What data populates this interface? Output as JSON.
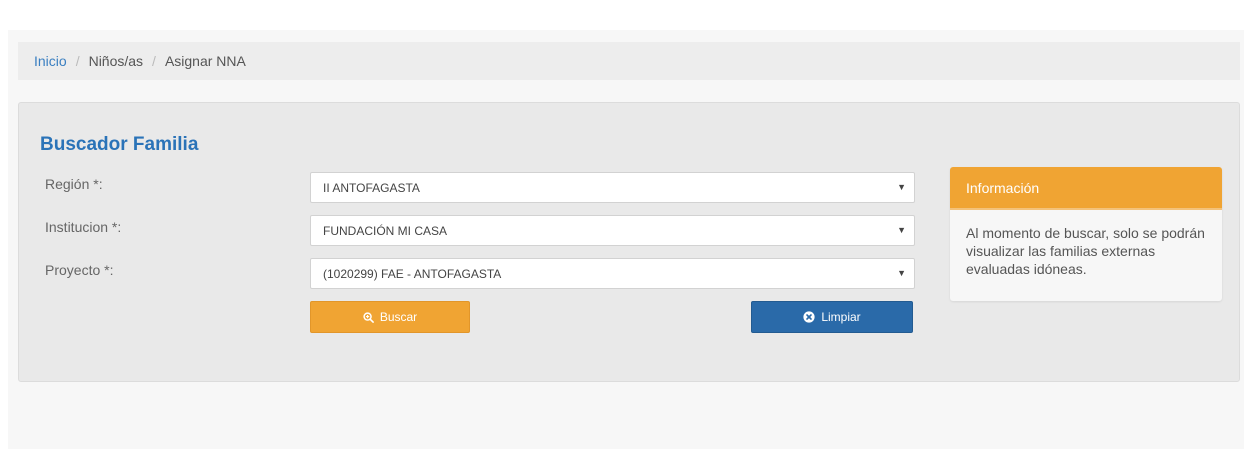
{
  "breadcrumb": {
    "items": [
      "Inicio",
      "Niños/as",
      "Asignar NNA"
    ],
    "separator": "/"
  },
  "panel": {
    "title": "Buscador Familia"
  },
  "form": {
    "region": {
      "label": "Región *:",
      "value": "II ANTOFAGASTA"
    },
    "institucion": {
      "label": "Institucion *:",
      "value": "FUNDACIÓN MI CASA"
    },
    "proyecto": {
      "label": "Proyecto *:",
      "value": "(1020299) FAE - ANTOFAGASTA"
    }
  },
  "buttons": {
    "buscar": {
      "label": "Buscar",
      "icon": "zoom-in-icon",
      "color": "#f0a433"
    },
    "limpiar": {
      "label": "Limpiar",
      "icon": "remove-circle-icon",
      "color": "#2a6aa9"
    }
  },
  "info": {
    "title": "Información",
    "text": "Al momento de buscar, solo se podrán visualizar las familias externas evaluadas idóneas.",
    "header_color": "#f0a433"
  },
  "colors": {
    "link": "#3a7fc1",
    "title": "#2a73b8"
  }
}
